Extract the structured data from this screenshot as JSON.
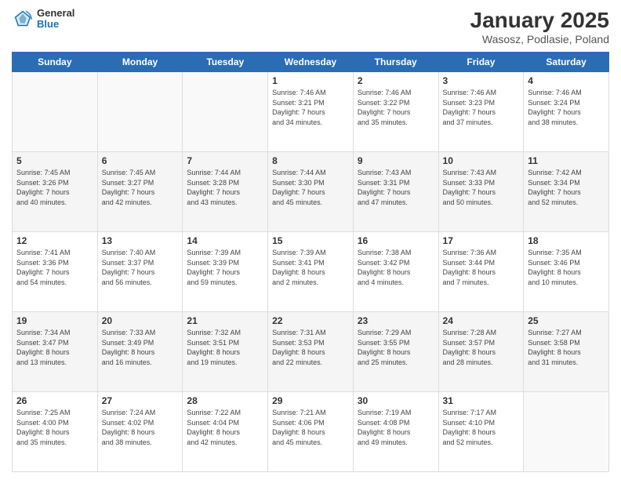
{
  "header": {
    "logo": {
      "general": "General",
      "blue": "Blue"
    },
    "title": "January 2025",
    "subtitle": "Wasosz, Podlasie, Poland"
  },
  "weekdays": [
    "Sunday",
    "Monday",
    "Tuesday",
    "Wednesday",
    "Thursday",
    "Friday",
    "Saturday"
  ],
  "weeks": [
    [
      {
        "day": "",
        "info": ""
      },
      {
        "day": "",
        "info": ""
      },
      {
        "day": "",
        "info": ""
      },
      {
        "day": "1",
        "info": "Sunrise: 7:46 AM\nSunset: 3:21 PM\nDaylight: 7 hours\nand 34 minutes."
      },
      {
        "day": "2",
        "info": "Sunrise: 7:46 AM\nSunset: 3:22 PM\nDaylight: 7 hours\nand 35 minutes."
      },
      {
        "day": "3",
        "info": "Sunrise: 7:46 AM\nSunset: 3:23 PM\nDaylight: 7 hours\nand 37 minutes."
      },
      {
        "day": "4",
        "info": "Sunrise: 7:46 AM\nSunset: 3:24 PM\nDaylight: 7 hours\nand 38 minutes."
      }
    ],
    [
      {
        "day": "5",
        "info": "Sunrise: 7:45 AM\nSunset: 3:26 PM\nDaylight: 7 hours\nand 40 minutes."
      },
      {
        "day": "6",
        "info": "Sunrise: 7:45 AM\nSunset: 3:27 PM\nDaylight: 7 hours\nand 42 minutes."
      },
      {
        "day": "7",
        "info": "Sunrise: 7:44 AM\nSunset: 3:28 PM\nDaylight: 7 hours\nand 43 minutes."
      },
      {
        "day": "8",
        "info": "Sunrise: 7:44 AM\nSunset: 3:30 PM\nDaylight: 7 hours\nand 45 minutes."
      },
      {
        "day": "9",
        "info": "Sunrise: 7:43 AM\nSunset: 3:31 PM\nDaylight: 7 hours\nand 47 minutes."
      },
      {
        "day": "10",
        "info": "Sunrise: 7:43 AM\nSunset: 3:33 PM\nDaylight: 7 hours\nand 50 minutes."
      },
      {
        "day": "11",
        "info": "Sunrise: 7:42 AM\nSunset: 3:34 PM\nDaylight: 7 hours\nand 52 minutes."
      }
    ],
    [
      {
        "day": "12",
        "info": "Sunrise: 7:41 AM\nSunset: 3:36 PM\nDaylight: 7 hours\nand 54 minutes."
      },
      {
        "day": "13",
        "info": "Sunrise: 7:40 AM\nSunset: 3:37 PM\nDaylight: 7 hours\nand 56 minutes."
      },
      {
        "day": "14",
        "info": "Sunrise: 7:39 AM\nSunset: 3:39 PM\nDaylight: 7 hours\nand 59 minutes."
      },
      {
        "day": "15",
        "info": "Sunrise: 7:39 AM\nSunset: 3:41 PM\nDaylight: 8 hours\nand 2 minutes."
      },
      {
        "day": "16",
        "info": "Sunrise: 7:38 AM\nSunset: 3:42 PM\nDaylight: 8 hours\nand 4 minutes."
      },
      {
        "day": "17",
        "info": "Sunrise: 7:36 AM\nSunset: 3:44 PM\nDaylight: 8 hours\nand 7 minutes."
      },
      {
        "day": "18",
        "info": "Sunrise: 7:35 AM\nSunset: 3:46 PM\nDaylight: 8 hours\nand 10 minutes."
      }
    ],
    [
      {
        "day": "19",
        "info": "Sunrise: 7:34 AM\nSunset: 3:47 PM\nDaylight: 8 hours\nand 13 minutes."
      },
      {
        "day": "20",
        "info": "Sunrise: 7:33 AM\nSunset: 3:49 PM\nDaylight: 8 hours\nand 16 minutes."
      },
      {
        "day": "21",
        "info": "Sunrise: 7:32 AM\nSunset: 3:51 PM\nDaylight: 8 hours\nand 19 minutes."
      },
      {
        "day": "22",
        "info": "Sunrise: 7:31 AM\nSunset: 3:53 PM\nDaylight: 8 hours\nand 22 minutes."
      },
      {
        "day": "23",
        "info": "Sunrise: 7:29 AM\nSunset: 3:55 PM\nDaylight: 8 hours\nand 25 minutes."
      },
      {
        "day": "24",
        "info": "Sunrise: 7:28 AM\nSunset: 3:57 PM\nDaylight: 8 hours\nand 28 minutes."
      },
      {
        "day": "25",
        "info": "Sunrise: 7:27 AM\nSunset: 3:58 PM\nDaylight: 8 hours\nand 31 minutes."
      }
    ],
    [
      {
        "day": "26",
        "info": "Sunrise: 7:25 AM\nSunset: 4:00 PM\nDaylight: 8 hours\nand 35 minutes."
      },
      {
        "day": "27",
        "info": "Sunrise: 7:24 AM\nSunset: 4:02 PM\nDaylight: 8 hours\nand 38 minutes."
      },
      {
        "day": "28",
        "info": "Sunrise: 7:22 AM\nSunset: 4:04 PM\nDaylight: 8 hours\nand 42 minutes."
      },
      {
        "day": "29",
        "info": "Sunrise: 7:21 AM\nSunset: 4:06 PM\nDaylight: 8 hours\nand 45 minutes."
      },
      {
        "day": "30",
        "info": "Sunrise: 7:19 AM\nSunset: 4:08 PM\nDaylight: 8 hours\nand 49 minutes."
      },
      {
        "day": "31",
        "info": "Sunrise: 7:17 AM\nSunset: 4:10 PM\nDaylight: 8 hours\nand 52 minutes."
      },
      {
        "day": "",
        "info": ""
      }
    ]
  ]
}
